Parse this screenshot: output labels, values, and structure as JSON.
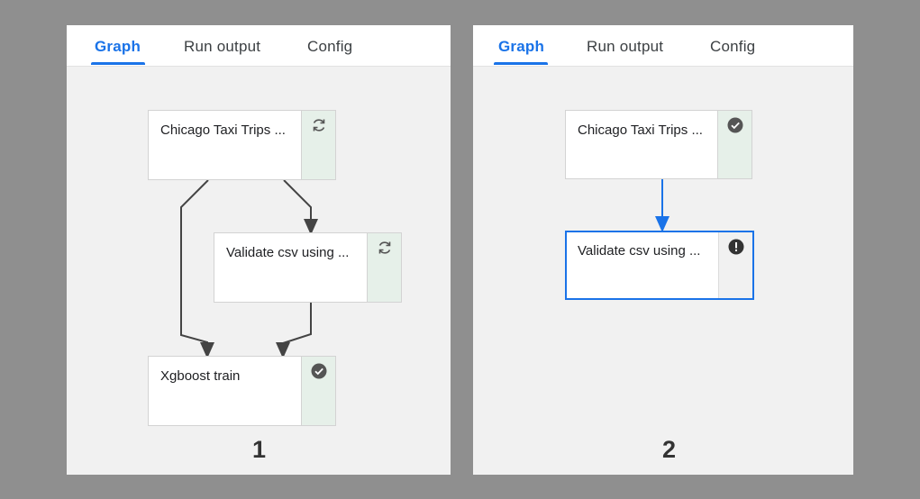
{
  "panels": [
    {
      "number": "1",
      "tabs": [
        {
          "label": "Graph",
          "active": true
        },
        {
          "label": "Run output",
          "active": false
        },
        {
          "label": "Config",
          "active": false
        }
      ],
      "nodes": [
        {
          "label": "Chicago Taxi Trips ...",
          "status_icon": "refresh-icon"
        },
        {
          "label": "Validate csv using ...",
          "status_icon": "refresh-icon"
        },
        {
          "label": "Xgboost train",
          "status_icon": "check-circle-icon"
        }
      ]
    },
    {
      "number": "2",
      "tabs": [
        {
          "label": "Graph",
          "active": true
        },
        {
          "label": "Run output",
          "active": false
        },
        {
          "label": "Config",
          "active": false
        }
      ],
      "nodes": [
        {
          "label": "Chicago Taxi Trips ...",
          "status_icon": "check-circle-icon"
        },
        {
          "label": "Validate csv using ...",
          "status_icon": "error-icon",
          "selected": true
        }
      ]
    }
  ],
  "colors": {
    "accent": "#1a73e8",
    "status_bg": "#e6f0e9",
    "edge": "#444444",
    "background": "#8f8f8f"
  }
}
